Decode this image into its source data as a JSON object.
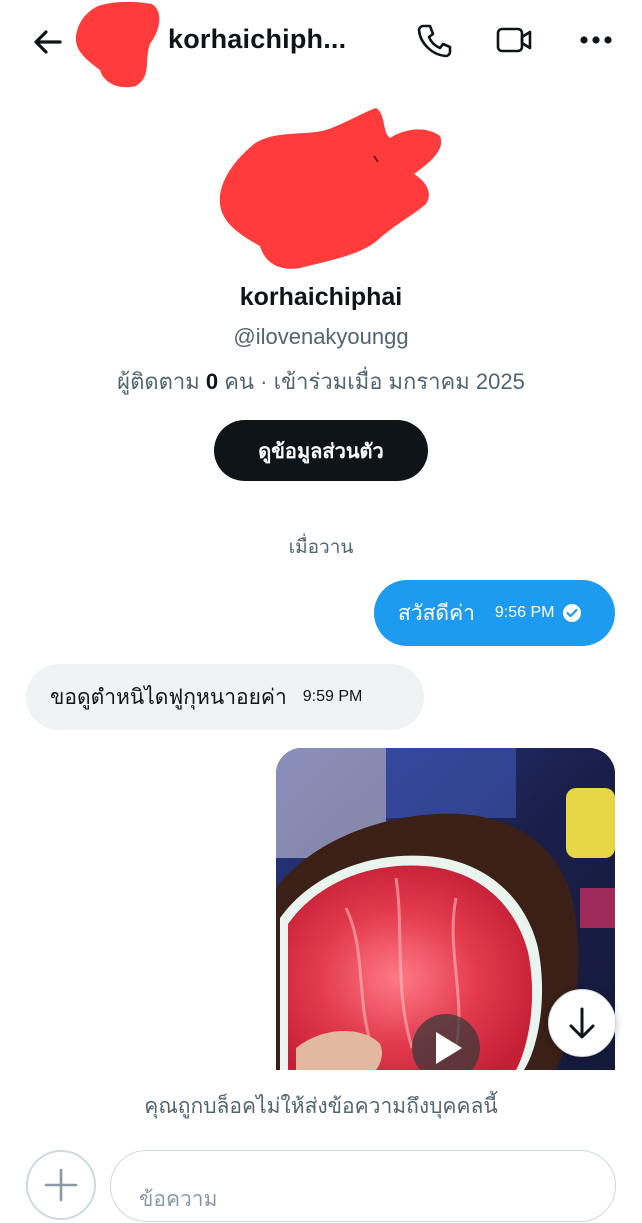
{
  "header": {
    "title": "korhaichiph...",
    "back_icon": "arrow-left-icon",
    "call_icon": "phone-icon",
    "video_icon": "video-camera-icon",
    "more_icon": "more-horizontal-icon"
  },
  "profile": {
    "name": "korhaichiphai",
    "handle": "@ilovenakyoungg",
    "followers_label": "ผู้ติดตาม",
    "followers_count": "0",
    "followers_unit": "คน",
    "separator": "·",
    "joined": "เข้าร่วมเมื่อ มกราคม 2025",
    "view_profile_label": "ดูข้อมูลส่วนตัว"
  },
  "conversation": {
    "date_separator": "เมื่อวาน",
    "messages": [
      {
        "direction": "outgoing",
        "text": "สวัสดีค่า",
        "time": "9:56 PM",
        "status": "read"
      },
      {
        "direction": "incoming",
        "text": "ขอดูตำหนิไดฟูกุหนาอยค่า",
        "time": "9:59 PM"
      },
      {
        "direction": "outgoing",
        "type": "video",
        "play_icon": "play-icon"
      }
    ]
  },
  "scroll_down_icon": "arrow-down-icon",
  "blocked_notice": "คุณถูกบล็อคไม่ให้ส่งข้อความถึงบุคคลนี้",
  "composer": {
    "plus_icon": "plus-icon",
    "placeholder": "ข้อความ"
  },
  "colors": {
    "accent": "#1d9bf0",
    "primary_text": "#0f1419",
    "secondary_text": "#536471",
    "incoming_bubble": "#eff3f4",
    "redaction": "#ff3b3b"
  }
}
